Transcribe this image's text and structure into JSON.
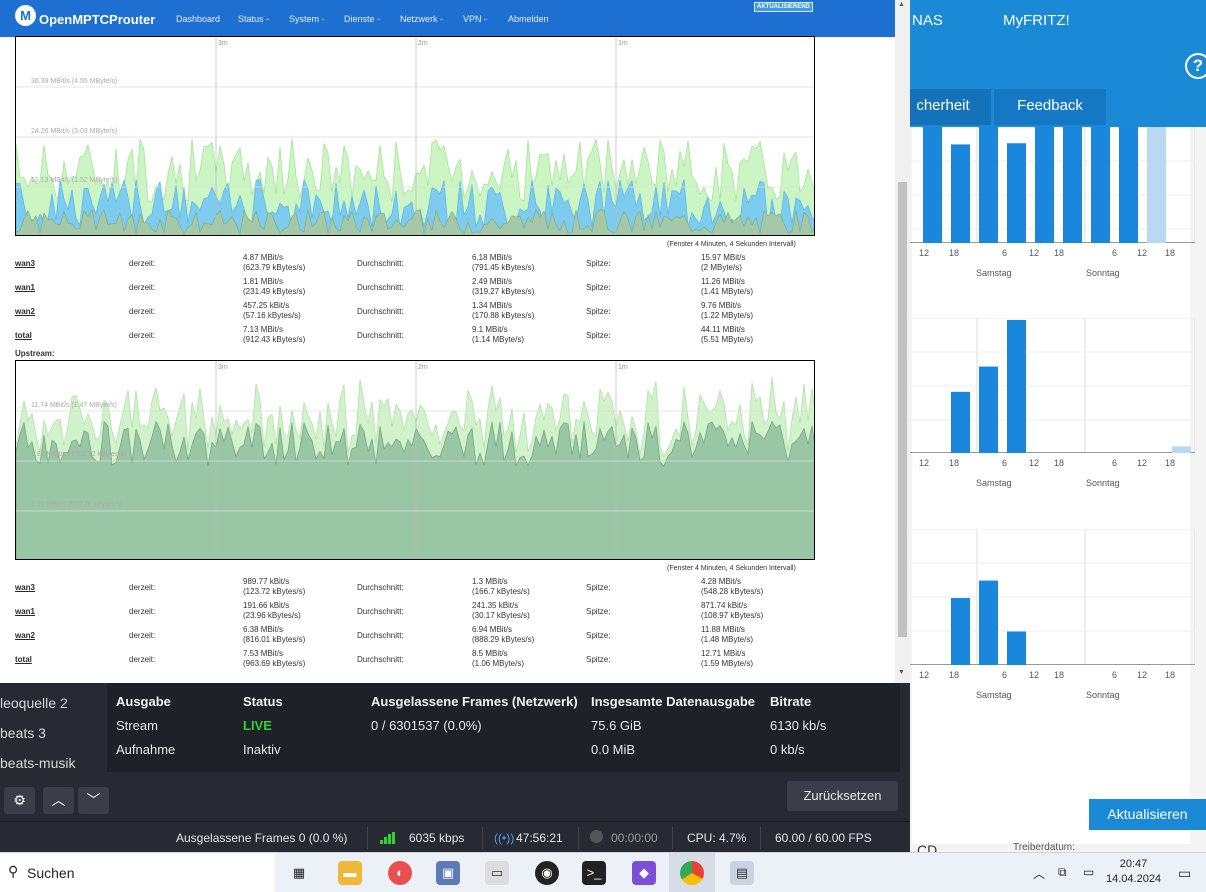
{
  "fritz": {
    "top_nas": "NAS",
    "top_myfritz": "MyFRITZ!",
    "help": "?",
    "tab_sicherheit": "cherheit",
    "tab_feedback": "Feedback",
    "charts": [
      {
        "x_labels": [
          "12",
          "18",
          "6",
          "12",
          "18",
          "6",
          "12",
          "18"
        ],
        "day_labels": [
          "Samstag",
          "Sonntag"
        ],
        "bars": [
          1.0,
          0.85,
          1.0,
          0.86,
          1.0,
          1.0,
          1.0,
          1.0,
          1.0
        ]
      },
      {
        "x_labels": [
          "12",
          "18",
          "6",
          "12",
          "18",
          "6",
          "12",
          "18"
        ],
        "day_labels": [
          "Samstag",
          "Sonntag"
        ],
        "bars": [
          0.46,
          0.65,
          1.0,
          0.05
        ]
      },
      {
        "x_labels": [
          "12",
          "18",
          "6",
          "12",
          "18",
          "6",
          "12",
          "18"
        ],
        "day_labels": [
          "Samstag",
          "Sonntag"
        ],
        "bars": [
          0.5,
          0.63,
          0.25
        ]
      }
    ],
    "refresh_button": "Aktualisieren",
    "bottom_left": "CD",
    "bottom_right": "Treiberdatum:"
  },
  "browser": {
    "brand": "OpenMPTCProuter",
    "nav": [
      "Dashboard",
      "Status -",
      "System -",
      "Dienste -",
      "Netzwerk -",
      "VPN -",
      "Abmelden"
    ],
    "badge": "AKTUALISIEREND",
    "download": {
      "time_labels": [
        "3m",
        "2m",
        "1m"
      ],
      "h_labels": [
        "36.39 MBit/s (4.55 MByte/s)",
        "24.26 MBit/s (3.03 MByte/s)",
        "12.13 MBit/s (1.52 MByte/s)"
      ],
      "interval": "(Fenster 4 Minuten, 4 Sekunden Intervall)",
      "rows": [
        {
          "name": "wan3",
          "cur1": "4.87 MBit/s",
          "cur2": "(623.79 kBytes/s)",
          "avg1": "6.18 MBit/s",
          "avg2": "(791.45 kBytes/s)",
          "peak1": "15.97 MBit/s",
          "peak2": "(2 MByte/s)"
        },
        {
          "name": "wan1",
          "cur1": "1.81 MBit/s",
          "cur2": "(231.49 kBytes/s)",
          "avg1": "2.49 MBit/s",
          "avg2": "(319.27 kBytes/s)",
          "peak1": "11.26 MBit/s",
          "peak2": "(1.41 MByte/s)"
        },
        {
          "name": "wan2",
          "cur1": "457.25 kBit/s",
          "cur2": "(57.16 kBytes/s)",
          "avg1": "1.34 MBit/s",
          "avg2": "(170.88 kBytes/s)",
          "peak1": "9.76 MBit/s",
          "peak2": "(1.22 MByte/s)"
        },
        {
          "name": "total",
          "cur1": "7.13 MBit/s",
          "cur2": "(912.43 kBytes/s)",
          "avg1": "9.1 MBit/s",
          "avg2": "(1.14 MByte/s)",
          "peak1": "44.11 MBit/s",
          "peak2": "(5.51 MByte/s)"
        }
      ]
    },
    "upstream_label": "Upstream:",
    "upload": {
      "time_labels": [
        "3m",
        "2m",
        "1m"
      ],
      "h_labels": [
        "11.74 MBit/s (1.47 MByte/s)",
        "7.82 MBit/s (1001.52 kBytes/s)",
        "3.91 MBit/s (500.76 kBytes/s)"
      ],
      "interval": "(Fenster 4 Minuten, 4 Sekunden Intervall)",
      "rows": [
        {
          "name": "wan3",
          "cur1": "989.77 kBit/s",
          "cur2": "(123.72 kBytes/s)",
          "avg1": "1.3 MBit/s",
          "avg2": "(166.7 kBytes/s)",
          "peak1": "4.28 MBit/s",
          "peak2": "(548.28 kBytes/s)"
        },
        {
          "name": "wan1",
          "cur1": "191.66 kBit/s",
          "cur2": "(23.96 kBytes/s)",
          "avg1": "241.35 kBit/s",
          "avg2": "(30.17 kBytes/s)",
          "peak1": "871.74 kBit/s",
          "peak2": "(108.97 kBytes/s)"
        },
        {
          "name": "wan2",
          "cur1": "6.38 MBit/s",
          "cur2": "(816.01 kBytes/s)",
          "avg1": "6.94 MBit/s",
          "avg2": "(888.29 kBytes/s)",
          "peak1": "11.88 MBit/s",
          "peak2": "(1.48 MByte/s)"
        },
        {
          "name": "total",
          "cur1": "7.53 MBit/s",
          "cur2": "(963.69 kBytes/s)",
          "avg1": "8.5 MBit/s",
          "avg2": "(1.06 MByte/s)",
          "peak1": "12.71 MBit/s",
          "peak2": "(1.59 MByte/s)"
        }
      ]
    },
    "labels": {
      "current": "derzeit:",
      "average": "Durchschnitt:",
      "peak": "Spitze:"
    }
  },
  "obs": {
    "sources": [
      "leoquelle 2",
      "beats 3",
      "beats-musik"
    ],
    "headers": [
      "Ausgabe",
      "Status",
      "Ausgelassene Frames (Netzwerk)",
      "Insgesamte Datenausgabe",
      "Bitrate"
    ],
    "rows": [
      [
        "Stream",
        "LIVE",
        "0 / 6301537 (0.0%)",
        "75.6 GiB",
        "6130 kb/s"
      ],
      [
        "Aufnahme",
        "Inaktiv",
        "",
        "0.0 MiB",
        "0 kb/s"
      ]
    ],
    "reset_button": "Zurücksetzen",
    "statusbar": {
      "dropped": "Ausgelassene Frames 0 (0.0 %)",
      "kbps": "6035 kbps",
      "stream_time": "47:56:21",
      "rec_time": "00:00:00",
      "cpu": "CPU: 4.7%",
      "fps": "60.00 / 60.00 FPS"
    }
  },
  "taskbar": {
    "search": "Suchen",
    "time": "20:47",
    "date": "14.04.2024"
  }
}
